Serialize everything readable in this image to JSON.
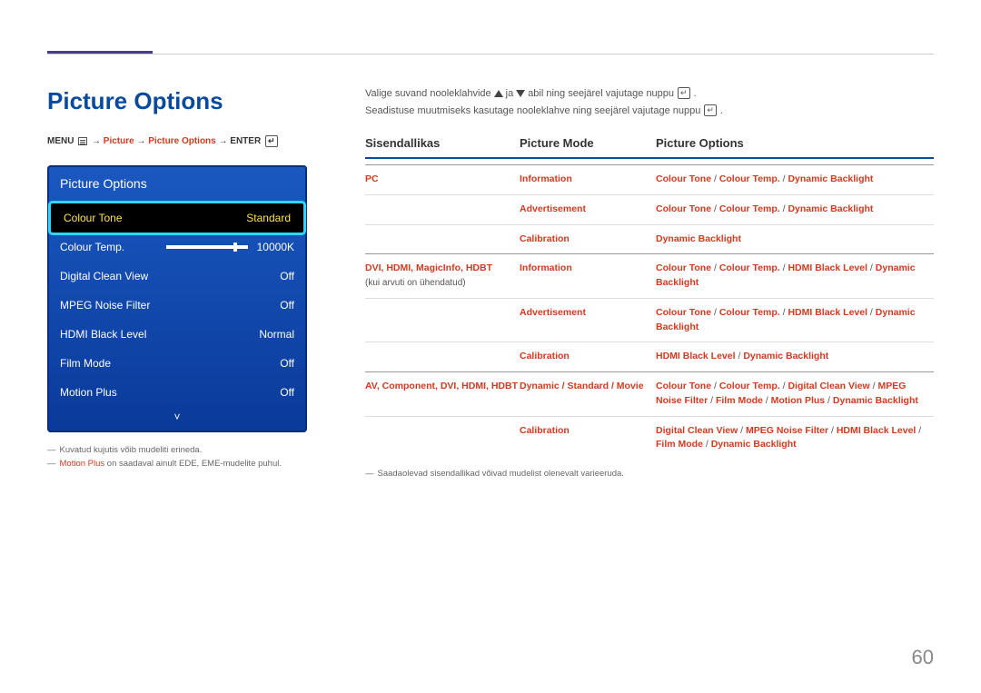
{
  "page_number": "60",
  "main_title": "Picture Options",
  "breadcrumb": {
    "prefix": "MENU",
    "arrow": "→",
    "p1": "Picture",
    "p2": "Picture Options",
    "suffix": "ENTER"
  },
  "osd": {
    "title": "Picture Options",
    "rows": [
      {
        "label": "Colour Tone",
        "value": "Standard",
        "selected": true
      },
      {
        "label": "Colour Temp.",
        "value": "10000K",
        "slider": true
      },
      {
        "label": "Digital Clean View",
        "value": "Off"
      },
      {
        "label": "MPEG Noise Filter",
        "value": "Off"
      },
      {
        "label": "HDMI Black Level",
        "value": "Normal"
      },
      {
        "label": "Film Mode",
        "value": "Off"
      },
      {
        "label": "Motion Plus",
        "value": "Off"
      }
    ],
    "more_glyph": "˅"
  },
  "left_footnotes": {
    "n1": "Kuvatud kujutis võib mudeliti erineda.",
    "n2a": "Motion Plus",
    "n2b": " on saadaval ainult EDE, EME-mudelite puhul."
  },
  "intro": {
    "line1a": "Valige suvand nooleklahvide ",
    "line1b": " ja ",
    "line1c": " abil ning seejärel vajutage nuppu ",
    "line1d": ".",
    "line2a": "Seadistuse muutmiseks kasutage nooleklahve ning seejärel vajutage nuppu ",
    "line2b": "."
  },
  "table": {
    "h1": "Sisendallikas",
    "h2": "Picture Mode",
    "h3": "Picture Options",
    "rows": [
      {
        "group_first": true,
        "src_red": "PC",
        "src_note": "",
        "mode": "Information",
        "opt": [
          "Colour Tone",
          " / ",
          "Colour Temp.",
          " / ",
          "Dynamic Backlight"
        ]
      },
      {
        "src_red": "",
        "src_note": "",
        "mode": "Advertisement",
        "opt": [
          "Colour Tone",
          " / ",
          "Colour Temp.",
          " / ",
          "Dynamic Backlight"
        ]
      },
      {
        "src_red": "",
        "src_note": "",
        "mode": "Calibration",
        "opt": [
          "Dynamic Backlight"
        ]
      },
      {
        "group_first": true,
        "src_red": "DVI, HDMI, MagicInfo, HDBT",
        "src_note": "(kui arvuti on ühendatud)",
        "mode": "Information",
        "opt": [
          "Colour Tone",
          " / ",
          "Colour Temp.",
          " / ",
          "HDMI Black Level",
          " / ",
          "Dynamic Backlight"
        ]
      },
      {
        "src_red": "",
        "src_note": "",
        "mode": "Advertisement",
        "opt": [
          "Colour Tone",
          " / ",
          "Colour Temp.",
          " / ",
          "HDMI Black Level",
          " / ",
          "Dynamic Backlight"
        ]
      },
      {
        "src_red": "",
        "src_note": "",
        "mode": "Calibration",
        "opt": [
          "HDMI Black Level",
          " / ",
          "Dynamic Backlight"
        ]
      },
      {
        "group_first": true,
        "src_red": "AV, Component, DVI, HDMI, HDBT",
        "src_note": "",
        "mode_plain": "Dynamic / Standard / Movie",
        "opt": [
          "Colour Tone",
          " / ",
          "Colour Temp.",
          " / ",
          "Digital Clean View",
          " / ",
          "MPEG Noise Filter",
          " / ",
          "Film Mode",
          " / ",
          "Motion Plus",
          " / ",
          "Dynamic Backlight"
        ]
      },
      {
        "src_red": "",
        "src_note": "",
        "mode": "Calibration",
        "opt": [
          "Digital Clean View",
          " / ",
          "MPEG Noise Filter",
          " / ",
          "HDMI Black Level",
          " / ",
          "Film Mode",
          " / ",
          "Dynamic Backlight"
        ]
      }
    ],
    "footer": "Saadaolevad sisendallikad võivad mudelist olenevalt varieeruda."
  }
}
